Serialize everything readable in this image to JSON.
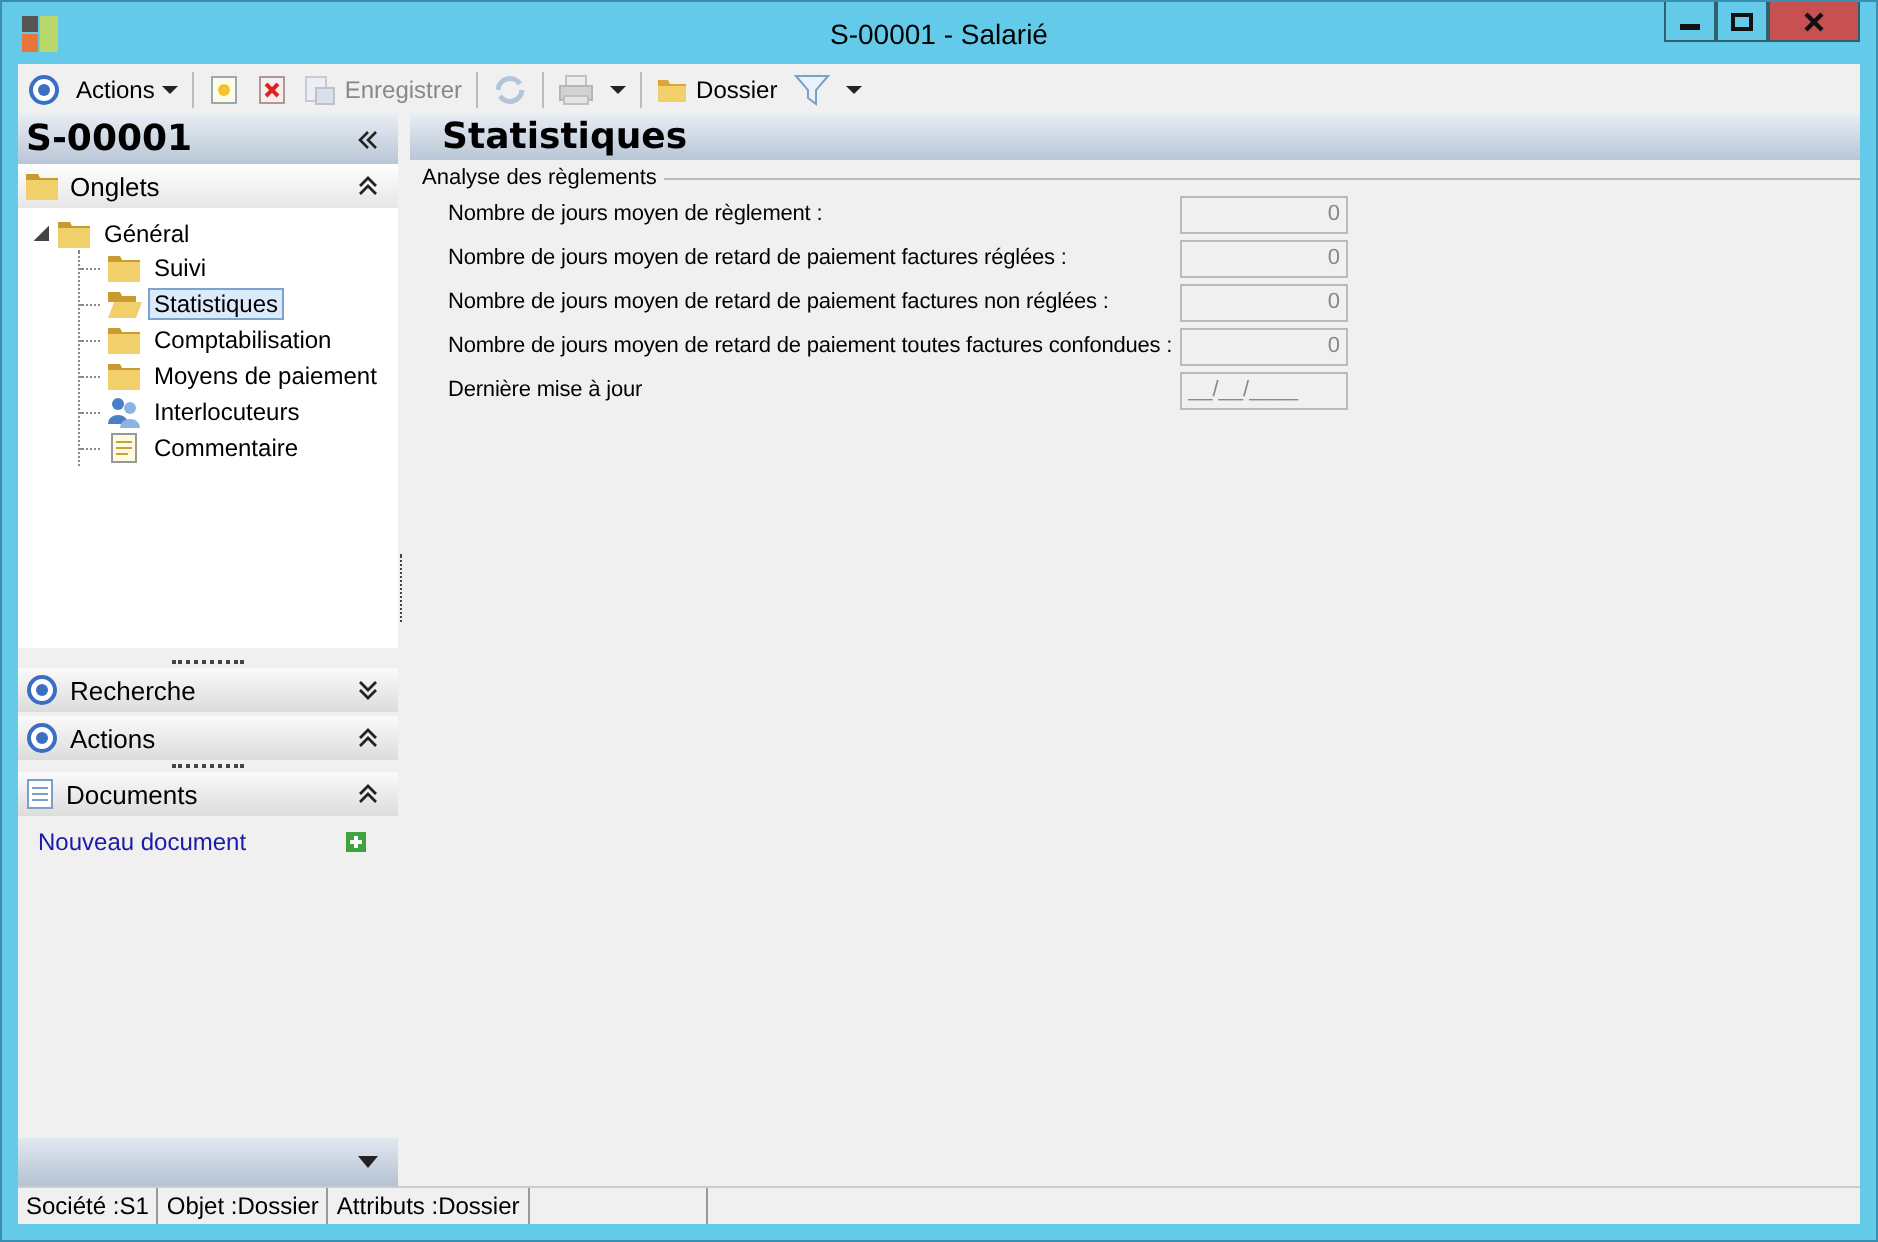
{
  "window": {
    "title": "S-00001 -  Salarié"
  },
  "toolbar": [
    {
      "kind": "target",
      "disabled": false
    },
    {
      "kind": "menu",
      "label": "Actions",
      "disabled": false
    },
    {
      "kind": "sep"
    },
    {
      "kind": "new",
      "disabled": false
    },
    {
      "kind": "delete",
      "disabled": false
    },
    {
      "kind": "save",
      "label": "Enregistrer",
      "disabled": true
    },
    {
      "kind": "sep"
    },
    {
      "kind": "refresh",
      "disabled": true
    },
    {
      "kind": "sep"
    },
    {
      "kind": "print",
      "disabled": true
    },
    {
      "kind": "dropdown",
      "disabled": false
    },
    {
      "kind": "sep"
    },
    {
      "kind": "folder",
      "label": "Dossier",
      "disabled": false
    },
    {
      "kind": "filter",
      "disabled": false
    },
    {
      "kind": "dropdown",
      "disabled": false
    }
  ],
  "sidebar": {
    "title": "S-00001",
    "onglets": {
      "label": "Onglets",
      "expanded": true,
      "tree": [
        {
          "label": "Général",
          "kind": "folder",
          "expanded": true,
          "selected": false,
          "children": [
            {
              "label": "Suivi",
              "kind": "folder",
              "selected": false
            },
            {
              "label": "Statistiques",
              "kind": "folder",
              "selected": true
            },
            {
              "label": "Comptabilisation",
              "kind": "folder",
              "selected": false
            },
            {
              "label": "Moyens de paiement",
              "kind": "folder",
              "selected": false
            },
            {
              "label": "Interlocuteurs",
              "kind": "contacts",
              "selected": false
            },
            {
              "label": "Commentaire",
              "kind": "note",
              "selected": false
            }
          ]
        }
      ]
    },
    "sections": [
      {
        "label": "Recherche",
        "expanded": false
      },
      {
        "label": "Actions",
        "expanded": true
      }
    ],
    "documents": {
      "label": "Documents",
      "expanded": true,
      "link": "Nouveau document"
    }
  },
  "content": {
    "title": "Statistiques",
    "group": "Analyse des règlements",
    "fields": [
      {
        "label": "Nombre de jours moyen de règlement :",
        "value": "0",
        "kind": "number"
      },
      {
        "label": "Nombre de jours moyen de retard de paiement factures réglées :",
        "value": "0",
        "kind": "number"
      },
      {
        "label": "Nombre de jours moyen de retard de paiement factures non réglées :",
        "value": "0",
        "kind": "number"
      },
      {
        "label": "Nombre de jours moyen de retard de paiement toutes factures confondues :",
        "value": "0",
        "kind": "number"
      },
      {
        "label": "Dernière mise à jour",
        "value": "__/__/____",
        "kind": "date"
      }
    ]
  },
  "status_bar": [
    "Société :S1",
    "Objet :Dossier",
    "Attributs :Dossier"
  ]
}
